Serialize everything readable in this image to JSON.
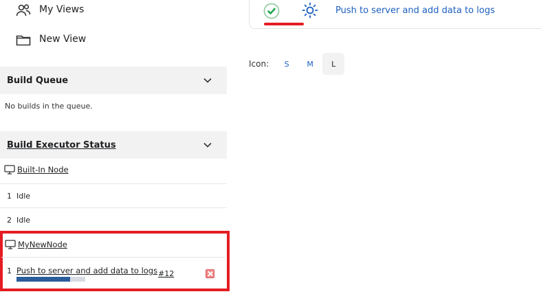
{
  "sidebar": {
    "nav": [
      {
        "label": "My Views",
        "icon": "people-icon"
      },
      {
        "label": "New View",
        "icon": "folder-icon"
      }
    ],
    "build_queue": {
      "title": "Build Queue",
      "empty_text": "No builds in the queue."
    },
    "executor_status": {
      "title": "Build Executor Status",
      "nodes": [
        {
          "name": "Built-In Node",
          "executors": [
            {
              "number": "1",
              "status": "Idle"
            },
            {
              "number": "2",
              "status": "Idle"
            }
          ]
        },
        {
          "name": "MyNewNode",
          "executors": [
            {
              "number": "1",
              "job": "Push to server and add data to logs",
              "build": "#12",
              "progress": 0.78
            }
          ]
        }
      ]
    }
  },
  "main": {
    "job": {
      "status": "success",
      "name": "Push to server and add data to logs"
    },
    "icon_size": {
      "label": "Icon:",
      "options": [
        "S",
        "M",
        "L"
      ],
      "selected": "L"
    }
  },
  "colors": {
    "accent_red": "#e51c23",
    "link_blue": "#1b5fbf",
    "success_green": "#1ea64b",
    "progress_fill": "#2b5d9b"
  }
}
